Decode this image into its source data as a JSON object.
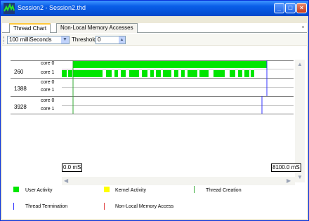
{
  "window": {
    "title": "Session2 - Session2.thd",
    "minimize": "_",
    "maximize": "□",
    "close": "×"
  },
  "tabs": [
    {
      "label": "Thread Chart",
      "active": true
    },
    {
      "label": "Non-Local Memory Accesses",
      "active": false
    }
  ],
  "tab_close": "×",
  "toolbar": {
    "interval": "100 milliSeconds",
    "threshold_label": "Threshold:",
    "threshold_value": "0"
  },
  "threads": [
    {
      "id": "260",
      "cores": [
        "core 0",
        "core 1"
      ]
    },
    {
      "id": "1388",
      "cores": [
        "core 0",
        "core 1"
      ]
    },
    {
      "id": "3928",
      "cores": [
        "core 0",
        "core 1"
      ]
    }
  ],
  "time_axis": {
    "start": "0.0 mS",
    "end": "8100.0 mS"
  },
  "legend": [
    {
      "label": "User Activity",
      "color": "#00e600",
      "kind": "block"
    },
    {
      "label": "Kernel Activity",
      "color": "#ffff00",
      "kind": "block"
    },
    {
      "label": "Thread Creation",
      "color": "#33aa33",
      "kind": "line"
    },
    {
      "label": "Thread Termination",
      "color": "#3333ff",
      "kind": "line"
    },
    {
      "label": "Non-Local Memory Access",
      "color": "#e04040",
      "kind": "line"
    }
  ],
  "colors": {
    "user_activity": "#00e600",
    "creation": "#33aa33",
    "termination": "#3333ff"
  }
}
